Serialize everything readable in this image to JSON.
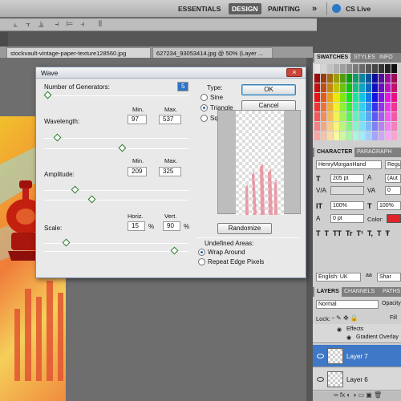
{
  "workspace": {
    "essentials": "ESSENTIALS",
    "design": "DESIGN",
    "painting": "PAINTING",
    "more": "»",
    "cs_live": "CS Live"
  },
  "tabs": [
    {
      "label": "stockvault-vintage-paper-texture128560.jpg"
    },
    {
      "label": "627234_93053414.jpg @ 50% (Layer ..."
    }
  ],
  "dialog": {
    "title": "Wave",
    "close": "×",
    "generators_label": "Number of Generators:",
    "generators_value": "5",
    "min_header": "Min.",
    "max_header": "Max.",
    "wavelength_label": "Wavelength:",
    "wavelength_min": "97",
    "wavelength_max": "537",
    "amplitude_label": "Amplitude:",
    "amplitude_min": "209",
    "amplitude_max": "325",
    "scale_label": "Scale:",
    "horiz_header": "Horiz.",
    "vert_header": "Vert.",
    "scale_horiz": "15",
    "scale_vert": "90",
    "percent": "%",
    "type_label": "Type:",
    "type_options": [
      "Sine",
      "Triangle",
      "Square"
    ],
    "type_selected": "Triangle",
    "ok": "OK",
    "cancel": "Cancel",
    "randomize": "Randomize",
    "undefined_label": "Undefined Areas:",
    "undefined_options": [
      "Wrap Around",
      "Repeat Edge Pixels"
    ],
    "undefined_selected": "Wrap Around",
    "slider_levels": {
      "generators": 0.02,
      "wavelength_min": 0.09,
      "wavelength_max": 0.54,
      "amplitude_min": 0.21,
      "amplitude_max": 0.33,
      "scale_horiz": 0.15,
      "scale_vert": 0.9
    }
  },
  "swatches": {
    "tabs": [
      "SWATCHES",
      "STYLES",
      "INFO"
    ]
  },
  "character": {
    "tabs": [
      "CHARACTER",
      "PARAGRAPH"
    ],
    "font_family": "HenryMorganHand",
    "font_style": "Regu",
    "size": "205 pt",
    "leading": "(Aut",
    "tracking": "0",
    "vscale": "100%",
    "hscale": "100%",
    "baseline": "0 pt",
    "color_label": "Color:",
    "color": "#e0242c",
    "style_buttons": [
      "T",
      "T",
      "TT",
      "Tr",
      "T¹",
      "T,",
      "T",
      "Ŧ"
    ],
    "language": "English: UK",
    "antialias": "Shar"
  },
  "layers": {
    "tabs": [
      "LAYERS",
      "CHANNELS",
      "PATHS"
    ],
    "blend_mode": "Normal",
    "opacity_label": "Opacity",
    "lock_label": "Lock:",
    "fill_label": "Fill",
    "effects_label": "Effects",
    "effect_item": "Gradient Overlay",
    "items": [
      {
        "name": "Layer 7",
        "selected": true
      },
      {
        "name": "Layer 6",
        "selected": false
      }
    ]
  }
}
